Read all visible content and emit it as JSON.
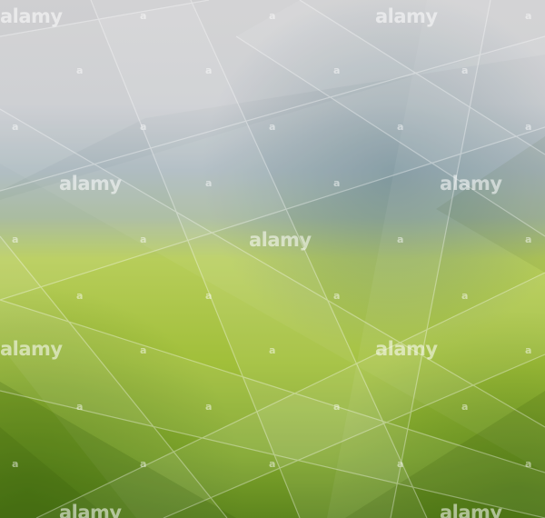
{
  "image": {
    "description_colors": {
      "top": "#cfcfd0",
      "mid_blue": "#8da2ad",
      "mid_green": "#b3c957",
      "bottom": "#5f8a1c"
    }
  },
  "watermark": {
    "word": "alamy",
    "mark": "a"
  }
}
